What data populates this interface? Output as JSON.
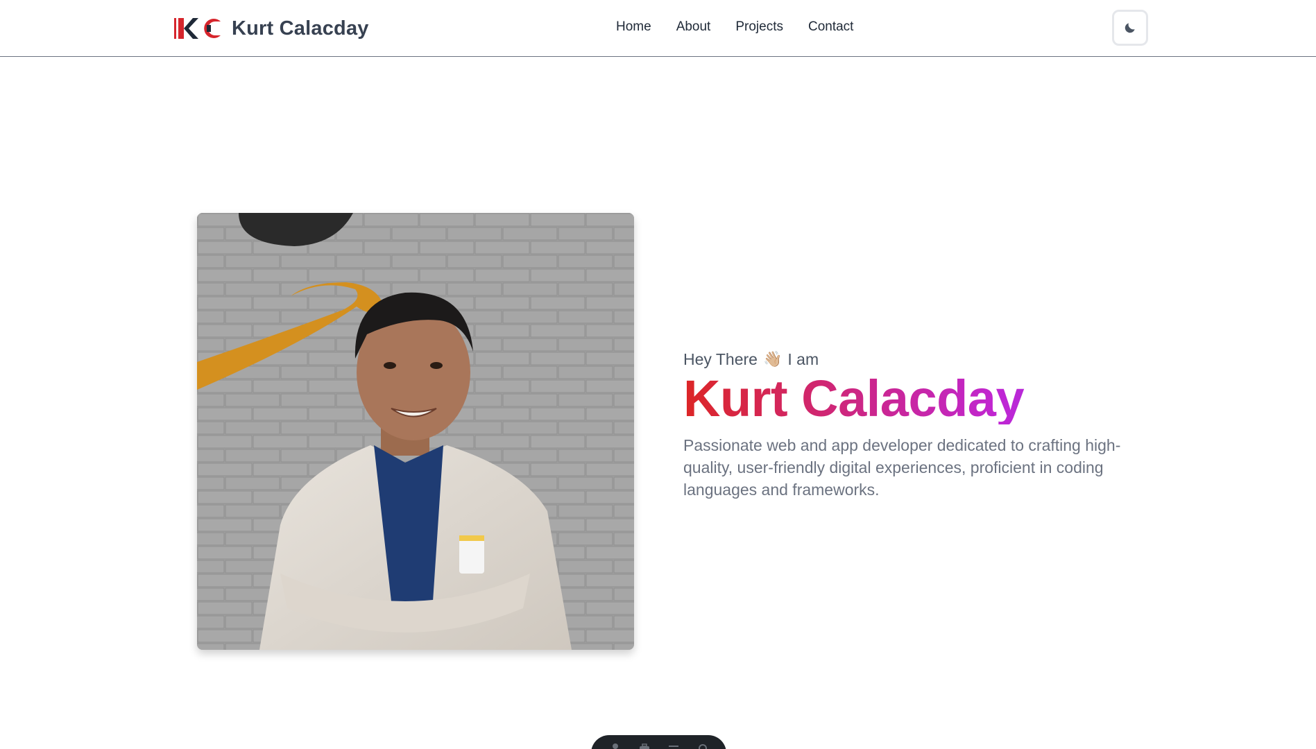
{
  "navbar": {
    "brand_name": "Kurt Calacday",
    "links": [
      {
        "label": "Home"
      },
      {
        "label": "About"
      },
      {
        "label": "Projects"
      },
      {
        "label": "Contact"
      }
    ],
    "theme_toggle_icon": "moon-icon"
  },
  "hero": {
    "greeting_before": "Hey There",
    "greeting_emoji": "👋🏼",
    "greeting_after": "I am",
    "name": "Kurt Calacday",
    "description": "Passionate web and app developer dedicated to crafting high-quality, user-friendly digital experiences, proficient in coding languages and frameworks.",
    "photo_icon": "profile-photo",
    "gradient_colors": [
      "#dc2626",
      "#c026d3",
      "#9333ea"
    ]
  },
  "dock": {
    "icons": [
      "user-icon",
      "briefcase-icon",
      "list-icon",
      "gear-icon"
    ]
  },
  "colors": {
    "logo_red": "#d6252c",
    "logo_dark": "#1f2937",
    "nav_border": "#6b7280",
    "text_muted": "#6b7280"
  }
}
